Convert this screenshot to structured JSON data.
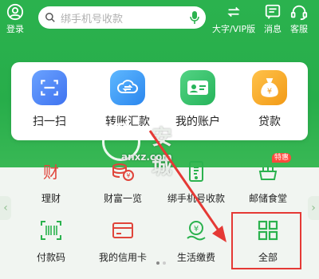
{
  "header": {
    "login_label": "登录",
    "search_placeholder": "绑手机号收款",
    "big_vip_label": "大字/VIP版",
    "message_label": "消息",
    "service_label": "客服"
  },
  "quick": [
    {
      "label": "扫一扫",
      "icon": "scan-icon"
    },
    {
      "label": "转账汇款",
      "icon": "transfer-icon"
    },
    {
      "label": "我的账户",
      "icon": "account-card-icon"
    },
    {
      "label": "贷款",
      "icon": "loan-bag-icon"
    }
  ],
  "grid": [
    {
      "label": "理财",
      "icon": "wealth-icon"
    },
    {
      "label": "财富一览",
      "icon": "coins-icon"
    },
    {
      "label": "绑手机号收款",
      "icon": "phone-receive-icon"
    },
    {
      "label": "邮储食堂",
      "icon": "canteen-icon",
      "badge": "特惠"
    },
    {
      "label": "付款码",
      "icon": "barcode-icon"
    },
    {
      "label": "我的信用卡",
      "icon": "credit-card-icon"
    },
    {
      "label": "生活缴费",
      "icon": "life-payment-icon"
    },
    {
      "label": "全部",
      "icon": "all-grid-icon"
    }
  ],
  "watermark": {
    "text": "安 城",
    "url": "anxz.com"
  },
  "colors": {
    "brand_green": "#2bb24e",
    "highlight_red": "#e53935"
  }
}
